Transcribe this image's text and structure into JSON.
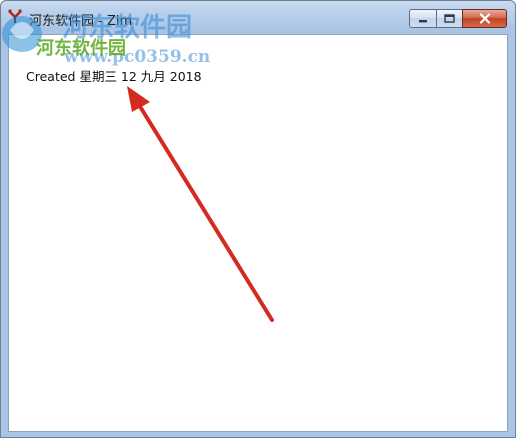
{
  "window": {
    "title": "河东软件园 - Zim",
    "buttons": {
      "minimize": "minimize-icon",
      "maximize": "maximize-icon",
      "close": "close-icon"
    }
  },
  "page": {
    "created_line": "Created 星期三 12 九月 2018"
  },
  "watermark": {
    "site_name": "河东软件园",
    "url": "www.pc0359.cn"
  },
  "colors": {
    "titlebar": "#b9d0ea",
    "close_button": "#c24226",
    "annotation_arrow": "#d42a22",
    "page_background": "#ffffff"
  }
}
